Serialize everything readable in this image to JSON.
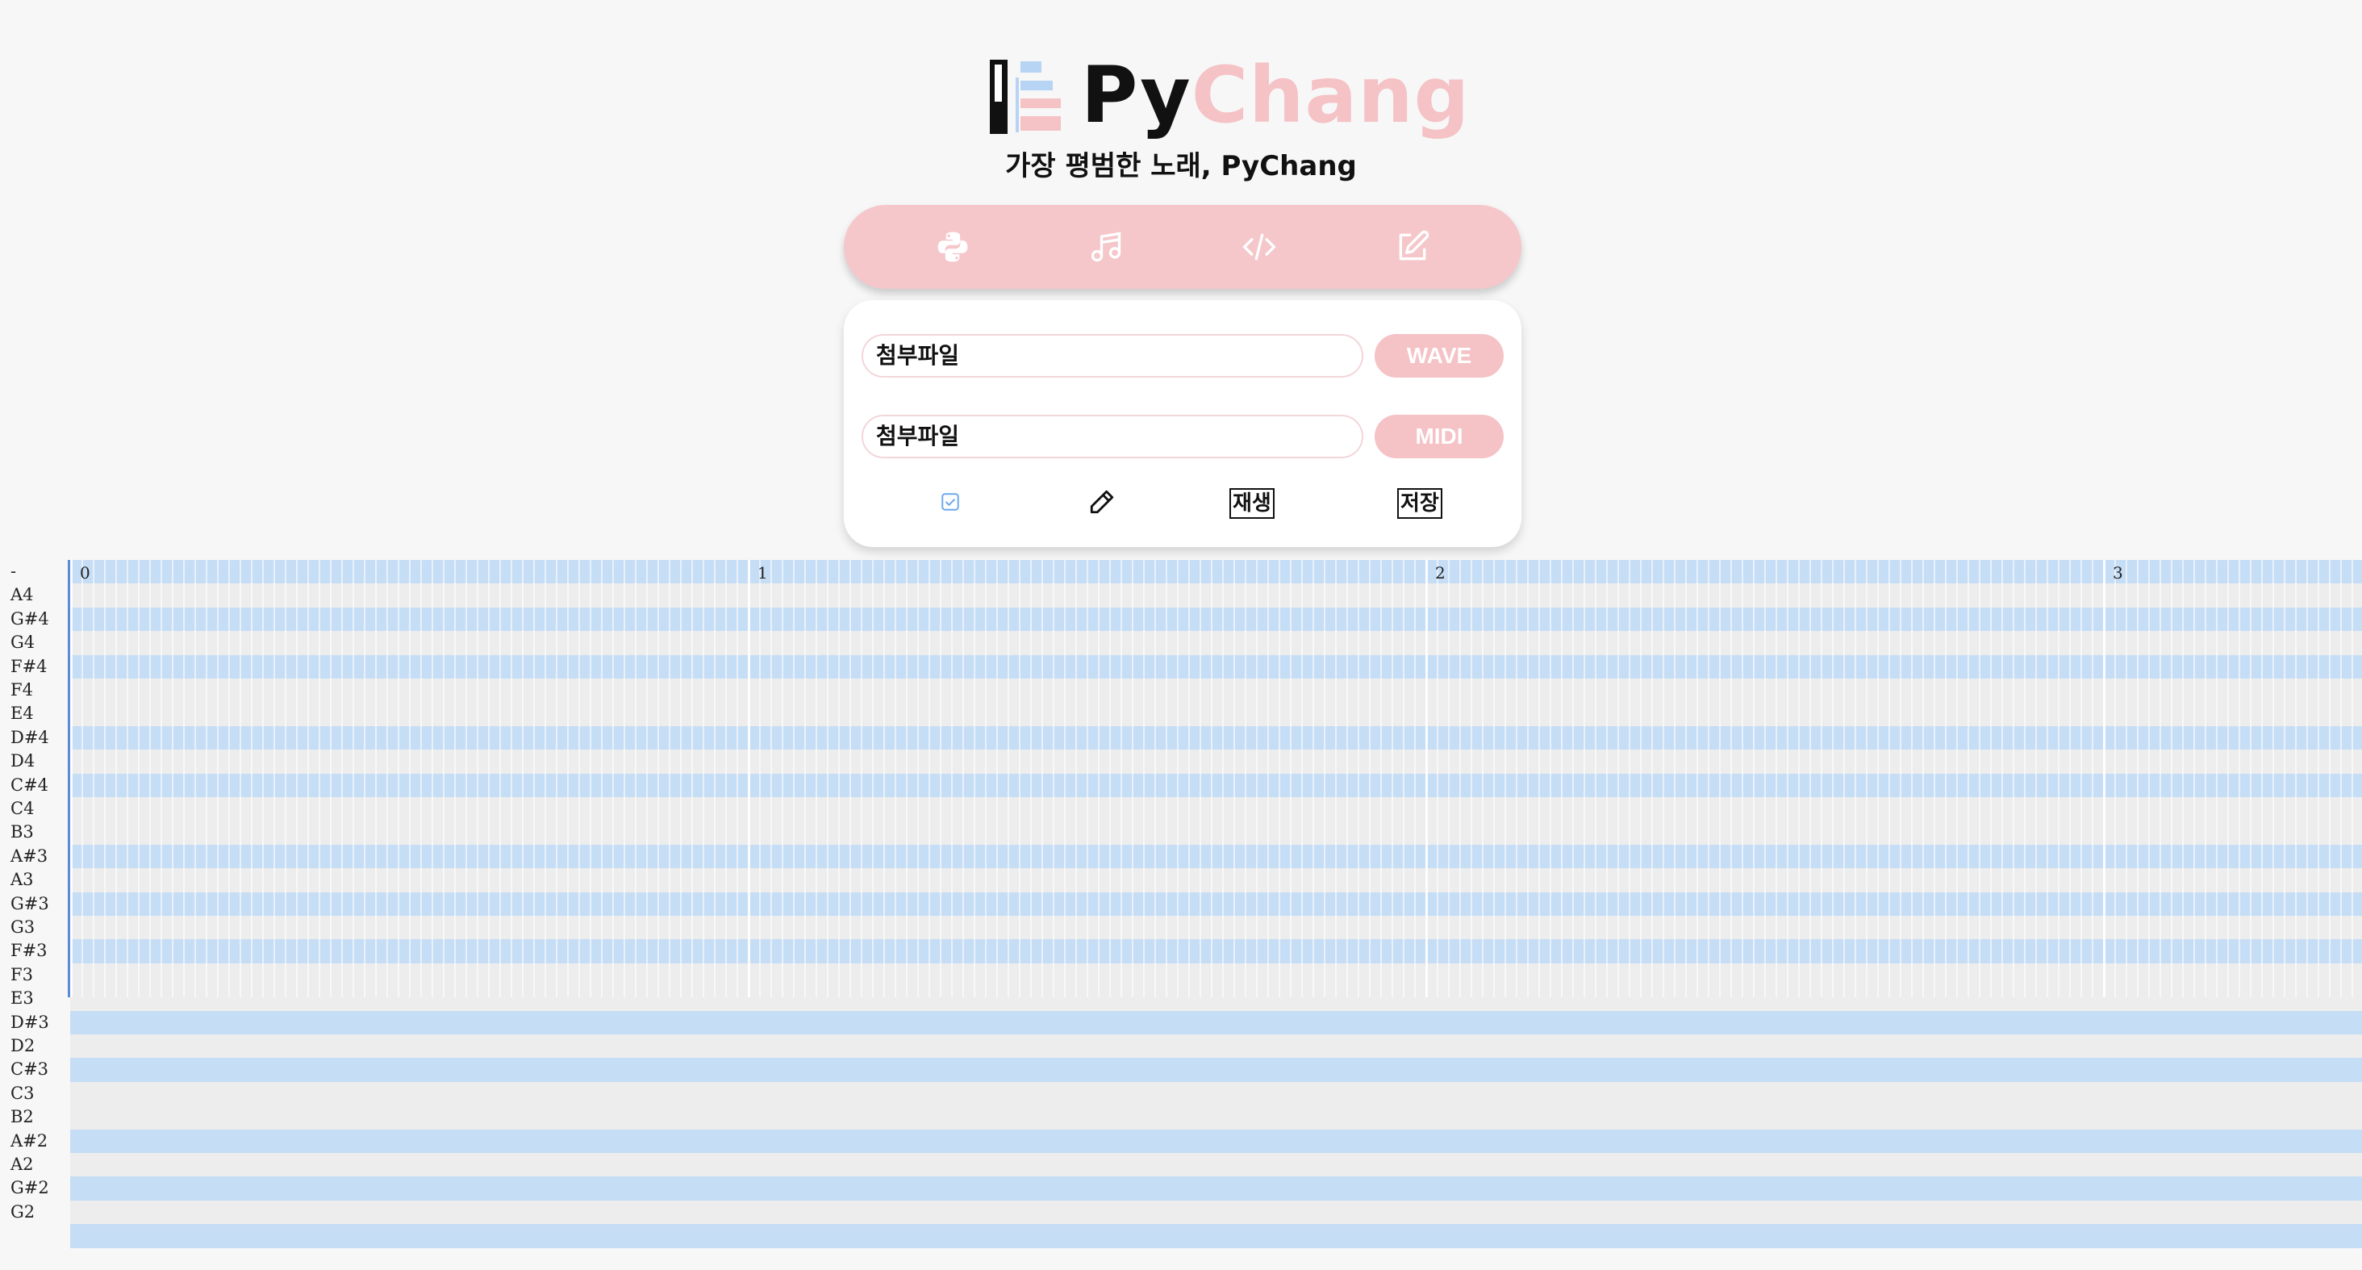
{
  "header": {
    "logo_py": "Py",
    "logo_chang": "Chang",
    "subtitle": "가장 평범한 노래, PyChang"
  },
  "nav": {
    "items": [
      {
        "icon": "python-icon"
      },
      {
        "icon": "music-note-icon"
      },
      {
        "icon": "code-icon"
      },
      {
        "icon": "edit-icon"
      }
    ]
  },
  "panel": {
    "wave_file_text": "첨부파일",
    "wave_button": "WAVE",
    "midi_file_text": "첨부파일",
    "midi_button": "MIDI",
    "play_label": "재생",
    "save_label": "저장"
  },
  "roll": {
    "notes": [
      "-",
      "A4",
      "G#4",
      "G4",
      "F#4",
      "F4",
      "E4",
      "D#4",
      "D4",
      "C#4",
      "C4",
      "B3",
      "A#3",
      "A3",
      "G#3",
      "G3",
      "F#3",
      "F3",
      "E3",
      "D#3",
      "D2",
      "C#3",
      "C3",
      "B2",
      "A#2",
      "A2",
      "G#2",
      "G2"
    ],
    "measures": [
      "0",
      "1",
      "2",
      "3"
    ]
  },
  "colors": {
    "accent_pink": "#f5c2c6",
    "sharp_row": "#c6ddf6",
    "natural_row": "#ededed"
  }
}
